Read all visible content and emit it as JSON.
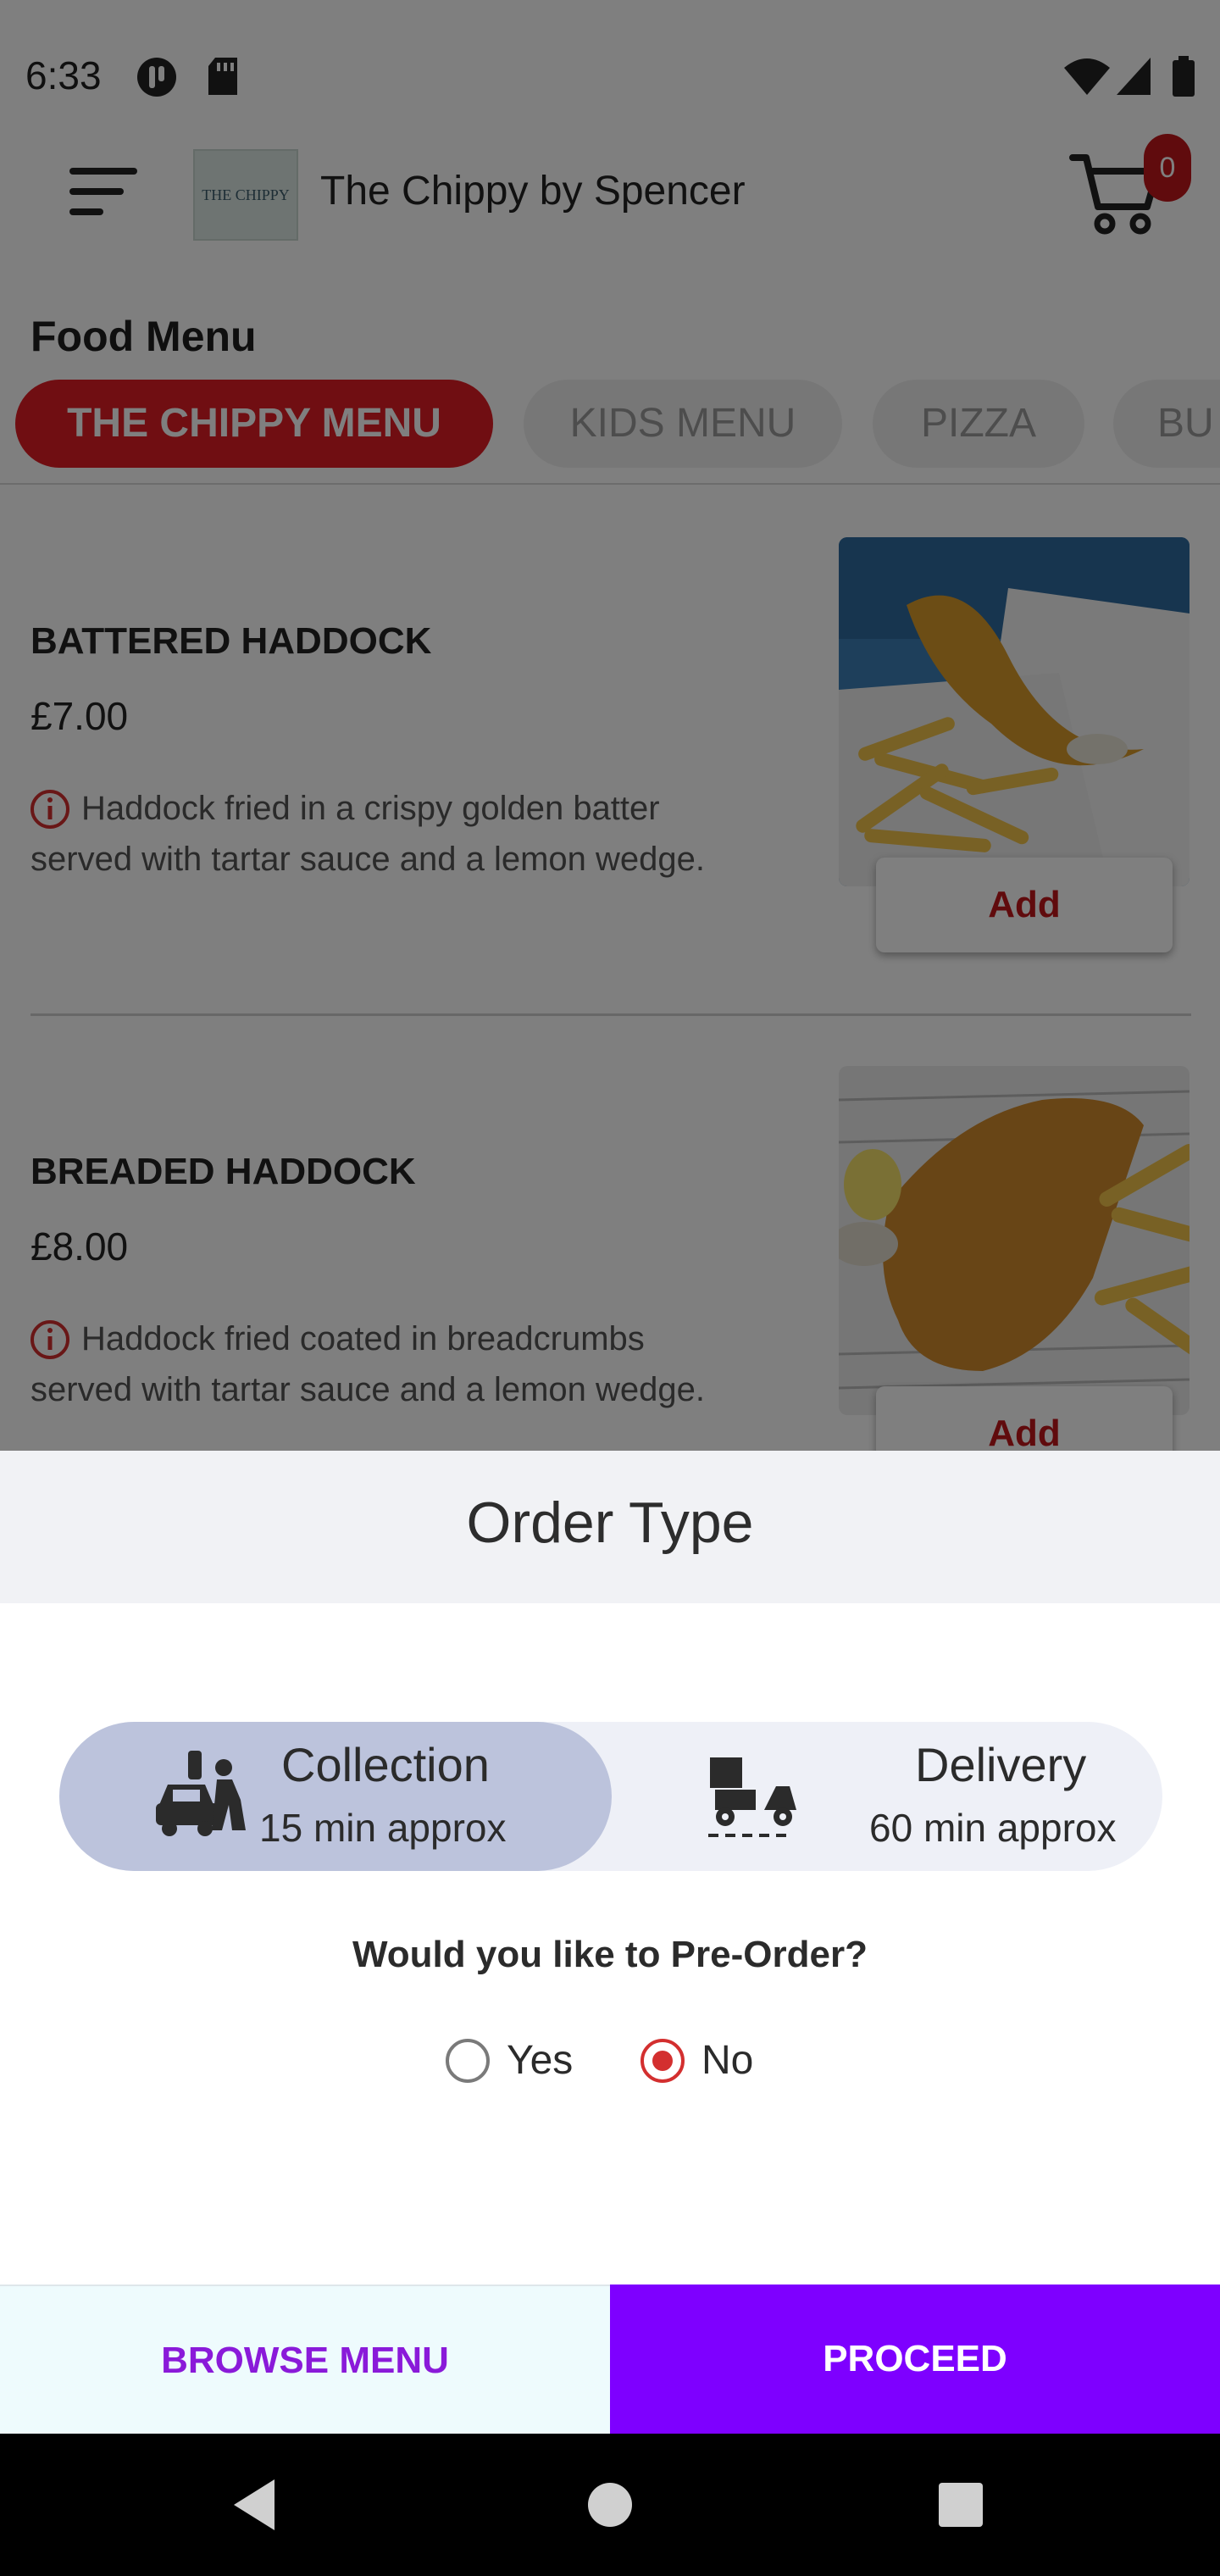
{
  "status_bar": {
    "time": "6:33"
  },
  "app_bar": {
    "shop_name": "The Chippy by Spencer",
    "logo_text": "THE CHIPPY",
    "cart_count": "0"
  },
  "menu": {
    "title": "Food Menu",
    "categories": [
      {
        "label": "THE CHIPPY MENU",
        "active": true
      },
      {
        "label": "KIDS MENU",
        "active": false
      },
      {
        "label": "PIZZA",
        "active": false
      },
      {
        "label": "BU",
        "active": false
      }
    ],
    "items": [
      {
        "name": "BATTERED HADDOCK",
        "price": "£7.00",
        "description": "Haddock fried in a crispy golden batter served with tartar sauce and a lemon wedge.",
        "add_label": "Add"
      },
      {
        "name": "BREADED HADDOCK",
        "price": "£8.00",
        "description": "Haddock fried coated in breadcrumbs served with tartar sauce and a lemon wedge.",
        "add_label": "Add"
      }
    ]
  },
  "order_sheet": {
    "title": "Order Type",
    "options": [
      {
        "name": "Collection",
        "time": "15 min approx",
        "selected": true,
        "icon": "collection-car-icon"
      },
      {
        "name": "Delivery",
        "time": "60 min approx",
        "selected": false,
        "icon": "delivery-scooter-icon"
      }
    ],
    "preorder_question": "Would you like to Pre-Order?",
    "preorder_yes": "Yes",
    "preorder_no": "No",
    "preorder_selected": "No",
    "browse_label": "BROWSE MENU",
    "proceed_label": "PROCEED"
  },
  "colors": {
    "brand_red": "#e11d24",
    "proceed_purple": "#7e00ff",
    "selected_option": "#bcc3dc"
  }
}
